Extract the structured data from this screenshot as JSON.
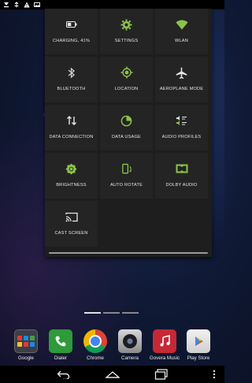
{
  "quick_settings": {
    "tiles": [
      {
        "label": "CHARGING, 41%",
        "icon": "battery-charging-icon"
      },
      {
        "label": "SETTINGS",
        "icon": "gear-icon"
      },
      {
        "label": "WLAN",
        "icon": "wifi-icon"
      },
      {
        "label": "BLUETOOTH",
        "icon": "bluetooth-icon"
      },
      {
        "label": "LOCATION",
        "icon": "location-icon"
      },
      {
        "label": "AEROPLANE MODE",
        "icon": "airplane-icon"
      },
      {
        "label": "DATA CONNECTION",
        "icon": "data-connection-icon"
      },
      {
        "label": "DATA USAGE",
        "icon": "data-usage-icon"
      },
      {
        "label": "AUDIO PROFILES",
        "icon": "audio-profiles-icon"
      },
      {
        "label": "BRIGHTNESS",
        "icon": "brightness-icon"
      },
      {
        "label": "AUTO ROTATE",
        "icon": "auto-rotate-icon"
      },
      {
        "label": "DOLBY AUDIO",
        "icon": "dolby-icon"
      },
      {
        "label": "CAST SCREEN",
        "icon": "cast-screen-icon"
      }
    ]
  },
  "dock": {
    "apps": [
      {
        "label": "Google",
        "icon": "google-folder-icon"
      },
      {
        "label": "Dialer",
        "icon": "phone-icon"
      },
      {
        "label": "Chrome",
        "icon": "chrome-icon"
      },
      {
        "label": "Camera",
        "icon": "camera-icon"
      },
      {
        "label": "Govera Music",
        "icon": "music-icon"
      },
      {
        "label": "Play Store",
        "icon": "play-store-icon"
      }
    ]
  },
  "colors": {
    "accent": "#8bc34a",
    "panel": "#1e1e1e",
    "tile": "#242424"
  }
}
